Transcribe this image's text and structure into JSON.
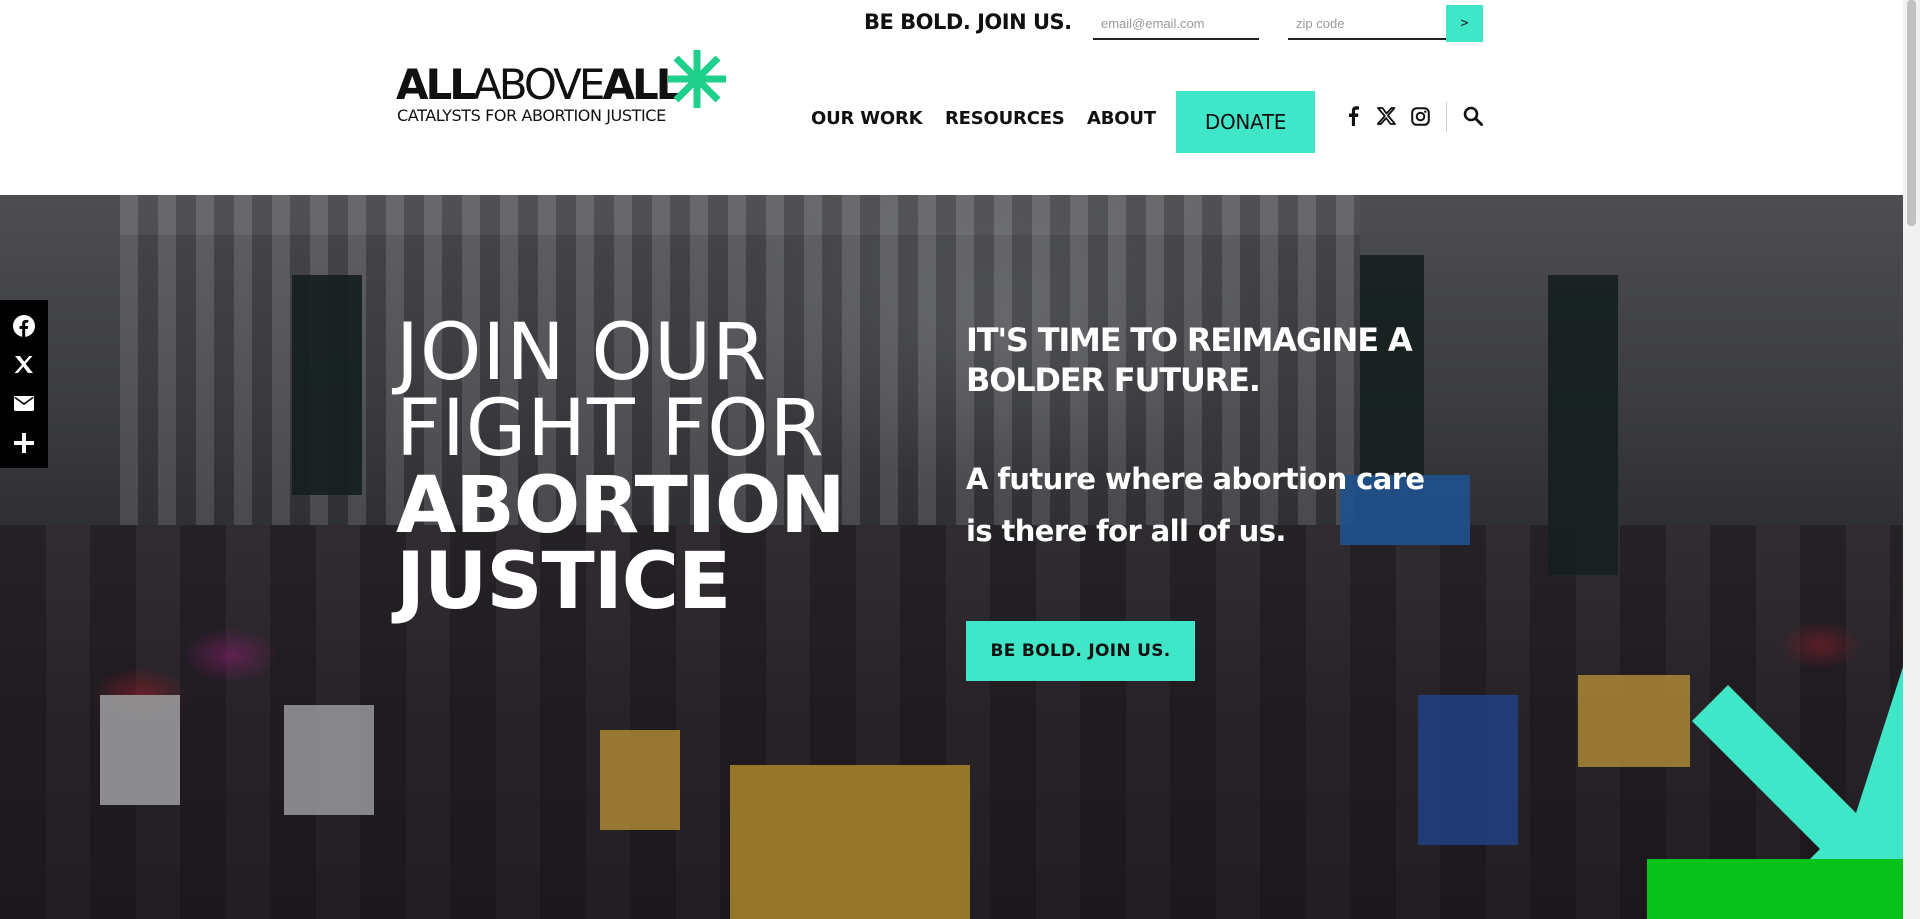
{
  "signup": {
    "title": "BE BOLD. JOIN US.",
    "email_placeholder": "email@email.com",
    "zip_placeholder": "zip code",
    "submit_label": ">"
  },
  "logo": {
    "word_bold_1": "ALL",
    "word_light": "ABOVE",
    "word_bold_2": "ALL",
    "tagline": "CATALYSTS FOR ABORTION JUSTICE"
  },
  "nav": {
    "items": [
      {
        "label": "OUR WORK"
      },
      {
        "label": "RESOURCES"
      },
      {
        "label": "ABOUT"
      }
    ],
    "donate_label": "DONATE",
    "social": [
      "facebook-icon",
      "x-icon",
      "instagram-icon"
    ],
    "search_icon": "search-icon"
  },
  "hero": {
    "headline_light_1": "JOIN OUR",
    "headline_light_2": "FIGHT FOR",
    "headline_heavy_1": "ABORTION",
    "headline_heavy_2": "JUSTICE",
    "kicker": "IT'S TIME TO REIMAGINE A BOLDER FUTURE.",
    "body": "A future where abortion care is there for all of us.",
    "cta_label": "BE BOLD. JOIN US."
  },
  "share": [
    "facebook-icon",
    "x-icon",
    "email-icon",
    "plus-icon"
  ],
  "colors": {
    "accent_teal": "#40e6c8",
    "accent_green": "#08c21c",
    "logo_star_green": "#1fd08a",
    "text_dark": "#111111"
  }
}
